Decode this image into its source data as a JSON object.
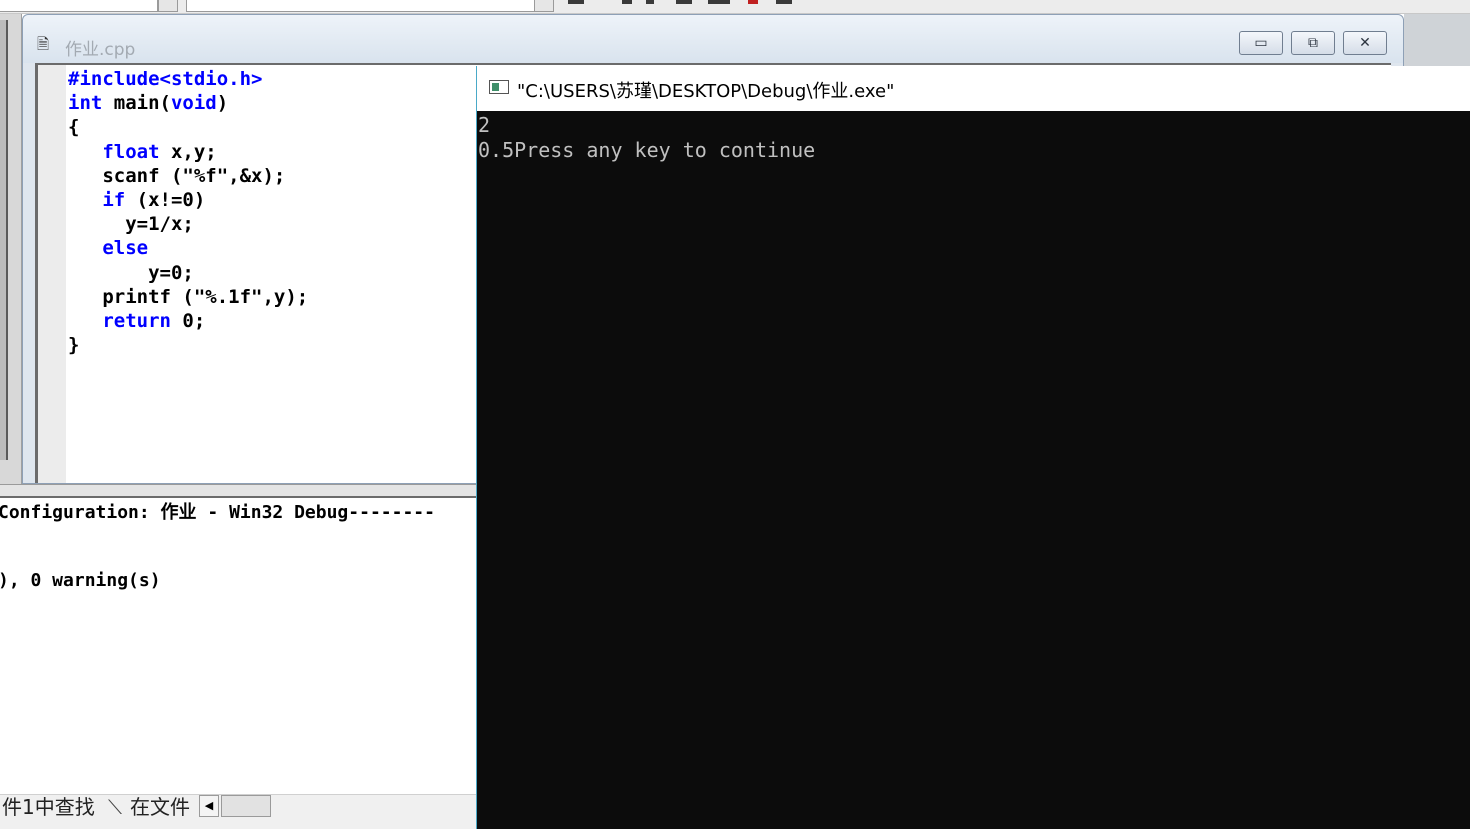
{
  "editor": {
    "file_title": "作业.cpp",
    "code_lines": [
      [
        {
          "t": "#include<stdio.h>",
          "kw": true
        }
      ],
      [
        {
          "t": "int",
          "kw": true
        },
        {
          "t": " main(",
          "kw": false
        },
        {
          "t": "void",
          "kw": true
        },
        {
          "t": ")",
          "kw": false
        }
      ],
      [
        {
          "t": "{",
          "kw": false
        }
      ],
      [
        {
          "t": "   ",
          "kw": false
        },
        {
          "t": "float",
          "kw": true
        },
        {
          "t": " x,y;",
          "kw": false
        }
      ],
      [
        {
          "t": "   scanf (\"%f\",&x);",
          "kw": false
        }
      ],
      [
        {
          "t": "   ",
          "kw": false
        },
        {
          "t": "if",
          "kw": true
        },
        {
          "t": " (x!=0)",
          "kw": false
        }
      ],
      [
        {
          "t": "     y=1/x;",
          "kw": false
        }
      ],
      [
        {
          "t": "   ",
          "kw": false
        },
        {
          "t": "else",
          "kw": true
        }
      ],
      [
        {
          "t": "       y=0;",
          "kw": false
        }
      ],
      [
        {
          "t": "   printf (\"%.1f\",y);",
          "kw": false
        }
      ],
      [
        {
          "t": "   ",
          "kw": false
        },
        {
          "t": "return",
          "kw": true
        },
        {
          "t": " 0;",
          "kw": false
        }
      ],
      [
        {
          "t": "}",
          "kw": false
        }
      ]
    ]
  },
  "window_buttons": {
    "minimize": "▭",
    "restore": "⧉",
    "close": "✕"
  },
  "output": {
    "line1": "Configuration: 作业 - Win32 Debug--------",
    "line2": "), 0 warning(s)"
  },
  "bottom_tabs": {
    "tab1": "件1中查找",
    "tab2": "在文件"
  },
  "console": {
    "title": "\"C:\\USERS\\苏瑾\\DESKTOP\\Debug\\作业.exe\"",
    "lines": [
      "2",
      "0.5Press any key to continue"
    ]
  }
}
